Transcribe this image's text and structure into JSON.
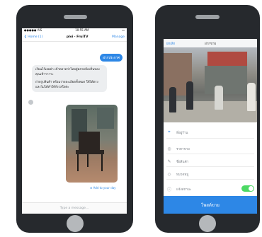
{
  "left_phone": {
    "status_bar": {
      "carrier": "●●●●● AIS",
      "time": "10:55 AM",
      "battery": "▭"
    },
    "nav": {
      "back_label": "❮ Home (1)",
      "title": "ploi · FruiTV",
      "manage_label": "Manage"
    },
    "messages": {
      "sent": "ฝากประกาศ",
      "received_1": "เรียนไว้เลยค่า เข้าตลาดว่าไทยสู่ตลาดท้องถิ่นของคุณเช้าาาาาะ",
      "received_2": "ถ่ายรูปสินค้า พร้อมรายละเอียดทั้งหมด ให้ได้ตรงและไม่ได้ทำให้กังวลใจค่ะ"
    },
    "add_link": "Add to your day",
    "input_placeholder": "Type a message..."
  },
  "right_phone": {
    "header": {
      "cancel_label": "ยกเลิก",
      "title": "ฝากขาย"
    },
    "fields": {
      "location": "ที่อยู่ร้าน",
      "price": "ราคาขาย",
      "name": "ชื่อสินค้า",
      "tag": "หมวดหมู่",
      "toggle_label": "แจ้งสถานะ"
    },
    "post_button": "โพสต์ขาย",
    "accent_color": "#2d87e6"
  }
}
